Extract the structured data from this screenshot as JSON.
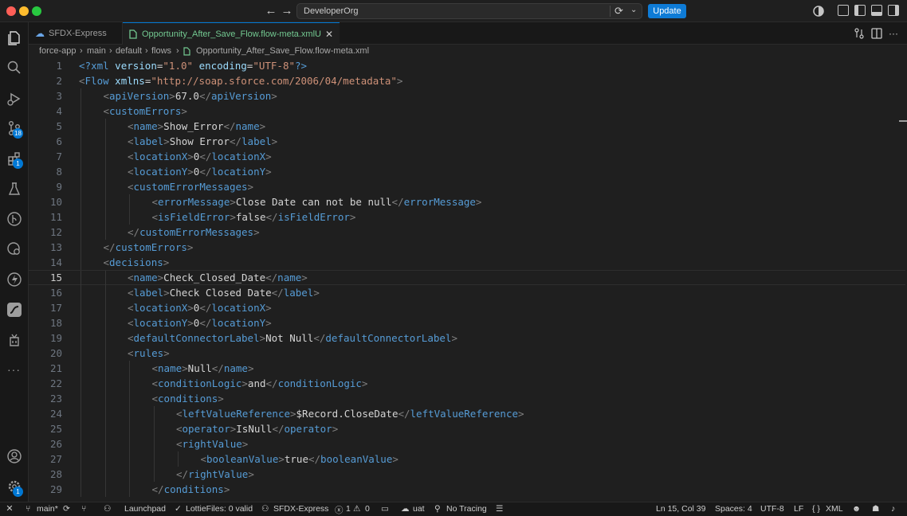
{
  "window": {
    "command_center": "DeveloperOrg",
    "update_label": "Update"
  },
  "tabs": [
    {
      "label": "SFDX-Express"
    },
    {
      "label": "Opportunity_After_Save_Flow.flow-meta.xml",
      "flag": "U"
    }
  ],
  "breadcrumb": [
    "force-app",
    "main",
    "default",
    "flows",
    "Opportunity_After_Save_Flow.flow-meta.xml"
  ],
  "badges": {
    "source_control": "18",
    "extensions": "1",
    "accounts": "1"
  },
  "editor": {
    "active_line": 15,
    "lines": [
      {
        "n": "1",
        "indent": 0,
        "tokens": [
          [
            "<?",
            "pi"
          ],
          [
            "xml",
            "pi"
          ],
          [
            " ",
            "txt"
          ],
          [
            "version",
            "attr"
          ],
          [
            "=",
            "txt"
          ],
          [
            "\"1.0\"",
            "str"
          ],
          [
            " ",
            "txt"
          ],
          [
            "encoding",
            "attr"
          ],
          [
            "=",
            "txt"
          ],
          [
            "\"UTF-8\"",
            "str"
          ],
          [
            "?>",
            "pi"
          ]
        ]
      },
      {
        "n": "2",
        "indent": 0,
        "tokens": [
          [
            "<",
            "ptag"
          ],
          [
            "Flow",
            "tname"
          ],
          [
            " ",
            "txt"
          ],
          [
            "xmlns",
            "attr"
          ],
          [
            "=",
            "txt"
          ],
          [
            "\"http://soap.sforce.com/2006/04/metadata\"",
            "str"
          ],
          [
            ">",
            "ptag"
          ]
        ]
      },
      {
        "n": "3",
        "indent": 1,
        "tokens": [
          [
            "<",
            "ptag"
          ],
          [
            "apiVersion",
            "tname"
          ],
          [
            ">",
            "ptag"
          ],
          [
            "67.0",
            "txt"
          ],
          [
            "</",
            "ptag"
          ],
          [
            "apiVersion",
            "tname"
          ],
          [
            ">",
            "ptag"
          ]
        ]
      },
      {
        "n": "4",
        "indent": 1,
        "tokens": [
          [
            "<",
            "ptag"
          ],
          [
            "customErrors",
            "tname"
          ],
          [
            ">",
            "ptag"
          ]
        ]
      },
      {
        "n": "5",
        "indent": 2,
        "tokens": [
          [
            "<",
            "ptag"
          ],
          [
            "name",
            "tname"
          ],
          [
            ">",
            "ptag"
          ],
          [
            "Show_Error",
            "txt"
          ],
          [
            "</",
            "ptag"
          ],
          [
            "name",
            "tname"
          ],
          [
            ">",
            "ptag"
          ]
        ]
      },
      {
        "n": "6",
        "indent": 2,
        "tokens": [
          [
            "<",
            "ptag"
          ],
          [
            "label",
            "tname"
          ],
          [
            ">",
            "ptag"
          ],
          [
            "Show Error",
            "txt"
          ],
          [
            "</",
            "ptag"
          ],
          [
            "label",
            "tname"
          ],
          [
            ">",
            "ptag"
          ]
        ]
      },
      {
        "n": "7",
        "indent": 2,
        "tokens": [
          [
            "<",
            "ptag"
          ],
          [
            "locationX",
            "tname"
          ],
          [
            ">",
            "ptag"
          ],
          [
            "0",
            "txt"
          ],
          [
            "</",
            "ptag"
          ],
          [
            "locationX",
            "tname"
          ],
          [
            ">",
            "ptag"
          ]
        ]
      },
      {
        "n": "8",
        "indent": 2,
        "tokens": [
          [
            "<",
            "ptag"
          ],
          [
            "locationY",
            "tname"
          ],
          [
            ">",
            "ptag"
          ],
          [
            "0",
            "txt"
          ],
          [
            "</",
            "ptag"
          ],
          [
            "locationY",
            "tname"
          ],
          [
            ">",
            "ptag"
          ]
        ]
      },
      {
        "n": "9",
        "indent": 2,
        "tokens": [
          [
            "<",
            "ptag"
          ],
          [
            "customErrorMessages",
            "tname"
          ],
          [
            ">",
            "ptag"
          ]
        ]
      },
      {
        "n": "10",
        "indent": 3,
        "tokens": [
          [
            "<",
            "ptag"
          ],
          [
            "errorMessage",
            "tname"
          ],
          [
            ">",
            "ptag"
          ],
          [
            "Close Date can not be null",
            "txt"
          ],
          [
            "</",
            "ptag"
          ],
          [
            "errorMessage",
            "tname"
          ],
          [
            ">",
            "ptag"
          ]
        ]
      },
      {
        "n": "11",
        "indent": 3,
        "tokens": [
          [
            "<",
            "ptag"
          ],
          [
            "isFieldError",
            "tname"
          ],
          [
            ">",
            "ptag"
          ],
          [
            "false",
            "txt"
          ],
          [
            "</",
            "ptag"
          ],
          [
            "isFieldError",
            "tname"
          ],
          [
            ">",
            "ptag"
          ]
        ]
      },
      {
        "n": "12",
        "indent": 2,
        "tokens": [
          [
            "</",
            "ptag"
          ],
          [
            "customErrorMessages",
            "tname"
          ],
          [
            ">",
            "ptag"
          ]
        ]
      },
      {
        "n": "13",
        "indent": 1,
        "tokens": [
          [
            "</",
            "ptag"
          ],
          [
            "customErrors",
            "tname"
          ],
          [
            ">",
            "ptag"
          ]
        ]
      },
      {
        "n": "14",
        "indent": 1,
        "tokens": [
          [
            "<",
            "ptag"
          ],
          [
            "decisions",
            "tname"
          ],
          [
            ">",
            "ptag"
          ]
        ]
      },
      {
        "n": "15",
        "indent": 2,
        "tokens": [
          [
            "<",
            "ptag"
          ],
          [
            "name",
            "tname"
          ],
          [
            ">",
            "ptag"
          ],
          [
            "Check_Closed_Date",
            "txt"
          ],
          [
            "</",
            "ptag"
          ],
          [
            "name",
            "tname"
          ],
          [
            ">",
            "ptag"
          ]
        ]
      },
      {
        "n": "16",
        "indent": 2,
        "tokens": [
          [
            "<",
            "ptag"
          ],
          [
            "label",
            "tname"
          ],
          [
            ">",
            "ptag"
          ],
          [
            "Check Closed Date",
            "txt"
          ],
          [
            "</",
            "ptag"
          ],
          [
            "label",
            "tname"
          ],
          [
            ">",
            "ptag"
          ]
        ]
      },
      {
        "n": "17",
        "indent": 2,
        "tokens": [
          [
            "<",
            "ptag"
          ],
          [
            "locationX",
            "tname"
          ],
          [
            ">",
            "ptag"
          ],
          [
            "0",
            "txt"
          ],
          [
            "</",
            "ptag"
          ],
          [
            "locationX",
            "tname"
          ],
          [
            ">",
            "ptag"
          ]
        ]
      },
      {
        "n": "18",
        "indent": 2,
        "tokens": [
          [
            "<",
            "ptag"
          ],
          [
            "locationY",
            "tname"
          ],
          [
            ">",
            "ptag"
          ],
          [
            "0",
            "txt"
          ],
          [
            "</",
            "ptag"
          ],
          [
            "locationY",
            "tname"
          ],
          [
            ">",
            "ptag"
          ]
        ]
      },
      {
        "n": "19",
        "indent": 2,
        "tokens": [
          [
            "<",
            "ptag"
          ],
          [
            "defaultConnectorLabel",
            "tname"
          ],
          [
            ">",
            "ptag"
          ],
          [
            "Not Null",
            "txt"
          ],
          [
            "</",
            "ptag"
          ],
          [
            "defaultConnectorLabel",
            "tname"
          ],
          [
            ">",
            "ptag"
          ]
        ]
      },
      {
        "n": "20",
        "indent": 2,
        "tokens": [
          [
            "<",
            "ptag"
          ],
          [
            "rules",
            "tname"
          ],
          [
            ">",
            "ptag"
          ]
        ]
      },
      {
        "n": "21",
        "indent": 3,
        "tokens": [
          [
            "<",
            "ptag"
          ],
          [
            "name",
            "tname"
          ],
          [
            ">",
            "ptag"
          ],
          [
            "Null",
            "txt"
          ],
          [
            "</",
            "ptag"
          ],
          [
            "name",
            "tname"
          ],
          [
            ">",
            "ptag"
          ]
        ]
      },
      {
        "n": "22",
        "indent": 3,
        "tokens": [
          [
            "<",
            "ptag"
          ],
          [
            "conditionLogic",
            "tname"
          ],
          [
            ">",
            "ptag"
          ],
          [
            "and",
            "txt"
          ],
          [
            "</",
            "ptag"
          ],
          [
            "conditionLogic",
            "tname"
          ],
          [
            ">",
            "ptag"
          ]
        ]
      },
      {
        "n": "23",
        "indent": 3,
        "tokens": [
          [
            "<",
            "ptag"
          ],
          [
            "conditions",
            "tname"
          ],
          [
            ">",
            "ptag"
          ]
        ]
      },
      {
        "n": "24",
        "indent": 4,
        "tokens": [
          [
            "<",
            "ptag"
          ],
          [
            "leftValueReference",
            "tname"
          ],
          [
            ">",
            "ptag"
          ],
          [
            "$Record.CloseDate",
            "txt"
          ],
          [
            "</",
            "ptag"
          ],
          [
            "leftValueReference",
            "tname"
          ],
          [
            ">",
            "ptag"
          ]
        ]
      },
      {
        "n": "25",
        "indent": 4,
        "tokens": [
          [
            "<",
            "ptag"
          ],
          [
            "operator",
            "tname"
          ],
          [
            ">",
            "ptag"
          ],
          [
            "IsNull",
            "txt"
          ],
          [
            "</",
            "ptag"
          ],
          [
            "operator",
            "tname"
          ],
          [
            ">",
            "ptag"
          ]
        ]
      },
      {
        "n": "26",
        "indent": 4,
        "tokens": [
          [
            "<",
            "ptag"
          ],
          [
            "rightValue",
            "tname"
          ],
          [
            ">",
            "ptag"
          ]
        ]
      },
      {
        "n": "27",
        "indent": 5,
        "tokens": [
          [
            "<",
            "ptag"
          ],
          [
            "booleanValue",
            "tname"
          ],
          [
            ">",
            "ptag"
          ],
          [
            "true",
            "txt"
          ],
          [
            "</",
            "ptag"
          ],
          [
            "booleanValue",
            "tname"
          ],
          [
            ">",
            "ptag"
          ]
        ]
      },
      {
        "n": "28",
        "indent": 4,
        "tokens": [
          [
            "</",
            "ptag"
          ],
          [
            "rightValue",
            "tname"
          ],
          [
            ">",
            "ptag"
          ]
        ]
      },
      {
        "n": "29",
        "indent": 3,
        "tokens": [
          [
            "</",
            "ptag"
          ],
          [
            "conditions",
            "tname"
          ],
          [
            ">",
            "ptag"
          ]
        ]
      }
    ]
  },
  "statusbar": {
    "branch": "main*",
    "launchpad": "Launchpad",
    "lottie": "LottieFiles: 0 valid",
    "org": "SFDX-Express",
    "errors": "1",
    "warnings": "0",
    "uat": "uat",
    "tracing": "No Tracing",
    "position": "Ln 15, Col 39",
    "spaces": "Spaces: 4",
    "encoding": "UTF-8",
    "eol": "LF",
    "language": "XML"
  },
  "colors": {
    "accent": "#0078d4",
    "update_button": "#0e7bd6",
    "tag": "#569cd6",
    "attribute": "#9cdcfe",
    "string": "#ce9178",
    "modified_file": "#73c991"
  }
}
